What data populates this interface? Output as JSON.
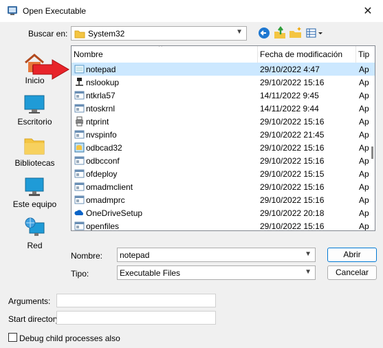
{
  "window": {
    "title": "Open Executable",
    "close_glyph": "✕"
  },
  "toolbar": {
    "look_in_label": "Buscar en:",
    "look_in_value": "System32",
    "back_icon": "back-arrow-icon",
    "up_icon": "up-folder-icon",
    "new_folder_icon": "new-folder-icon",
    "view_icon": "view-menu-icon"
  },
  "places": [
    {
      "label": "Inicio",
      "icon": "home-icon"
    },
    {
      "label": "Escritorio",
      "icon": "desktop-icon"
    },
    {
      "label": "Bibliotecas",
      "icon": "libraries-icon"
    },
    {
      "label": "Este equipo",
      "icon": "computer-icon"
    },
    {
      "label": "Red",
      "icon": "network-icon"
    }
  ],
  "columns": {
    "name": "Nombre",
    "date": "Fecha de modificación",
    "type": "Tip"
  },
  "files": [
    {
      "name": "notepad",
      "date": "29/10/2022 4:47",
      "type": "Ap"
    },
    {
      "name": "nslookup",
      "date": "29/10/2022 15:16",
      "type": "Ap"
    },
    {
      "name": "ntkrla57",
      "date": "14/11/2022 9:45",
      "type": "Ap"
    },
    {
      "name": "ntoskrnl",
      "date": "14/11/2022 9:44",
      "type": "Ap"
    },
    {
      "name": "ntprint",
      "date": "29/10/2022 15:16",
      "type": "Ap"
    },
    {
      "name": "nvspinfo",
      "date": "29/10/2022 21:45",
      "type": "Ap"
    },
    {
      "name": "odbcad32",
      "date": "29/10/2022 15:16",
      "type": "Ap"
    },
    {
      "name": "odbcconf",
      "date": "29/10/2022 15:16",
      "type": "Ap"
    },
    {
      "name": "ofdeploy",
      "date": "29/10/2022 15:15",
      "type": "Ap"
    },
    {
      "name": "omadmclient",
      "date": "29/10/2022 15:16",
      "type": "Ap"
    },
    {
      "name": "omadmprc",
      "date": "29/10/2022 15:16",
      "type": "Ap"
    },
    {
      "name": "OneDriveSetup",
      "date": "29/10/2022 20:18",
      "type": "Ap"
    },
    {
      "name": "openfiles",
      "date": "29/10/2022 15:16",
      "type": "Ap"
    }
  ],
  "selected_file": "notepad",
  "form": {
    "name_label": "Nombre:",
    "name_value": "notepad",
    "type_label": "Tipo:",
    "type_value": "Executable Files",
    "open_button": "Abrir",
    "cancel_button": "Cancelar",
    "arguments_label": "Arguments:",
    "arguments_value": "",
    "start_dir_label": "Start directory:",
    "start_dir_value": "",
    "debug_label": "Debug child processes also",
    "debug_checked": false
  },
  "colors": {
    "selection": "#cce8ff",
    "accent": "#0078d4",
    "arrow": "#e8242a"
  }
}
